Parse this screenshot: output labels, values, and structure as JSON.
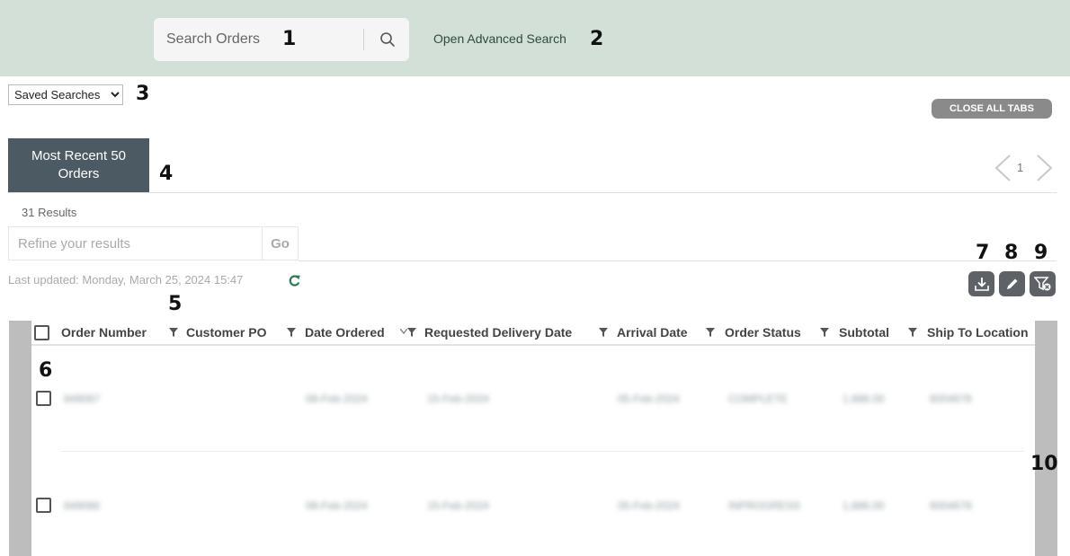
{
  "header": {
    "search_placeholder": "Search Orders",
    "advanced_search": "Open Advanced Search",
    "background_color": "#d2e0d7"
  },
  "saved_searches": {
    "selected": "Saved Searches"
  },
  "close_all_tabs": "CLOSE ALL TABS",
  "tabs": [
    {
      "label": "Most Recent 50 Orders",
      "active": true
    }
  ],
  "pagination": {
    "current_page": "1"
  },
  "results_count": "31 Results",
  "refine": {
    "placeholder": "Refine your results",
    "go": "Go"
  },
  "last_updated": "Last updated: Monday, March 25, 2024 15:47",
  "actions": [
    {
      "name": "download",
      "icon": "download-icon"
    },
    {
      "name": "edit",
      "icon": "pencil-icon"
    },
    {
      "name": "clear-filter",
      "icon": "filter-clear-icon"
    }
  ],
  "table": {
    "columns": [
      "Order Number",
      "Customer PO",
      "Date Ordered",
      "Requested Delivery Date",
      "Arrival Date",
      "Order Status",
      "Subtotal",
      "Ship To Location"
    ],
    "rows": [
      {
        "order_number": "849067",
        "customer_po": "",
        "date_ordered": "08-Feb-2024",
        "requested_delivery": "15-Feb-2024",
        "arrival_date": "05-Feb-2024",
        "order_status": "COMPLETE",
        "subtotal": "1,686.00",
        "ship_to": "6004678",
        "blurred": true
      },
      {
        "order_number": "849066",
        "customer_po": "",
        "date_ordered": "08-Feb-2024",
        "requested_delivery": "15-Feb-2024",
        "arrival_date": "05-Feb-2024",
        "order_status": "INPROGRESS",
        "subtotal": "1,686.00",
        "ship_to": "6004678",
        "blurred": true
      }
    ]
  },
  "markers": [
    "1",
    "2",
    "3",
    "4",
    "5",
    "6",
    "7",
    "8",
    "9",
    "10"
  ]
}
